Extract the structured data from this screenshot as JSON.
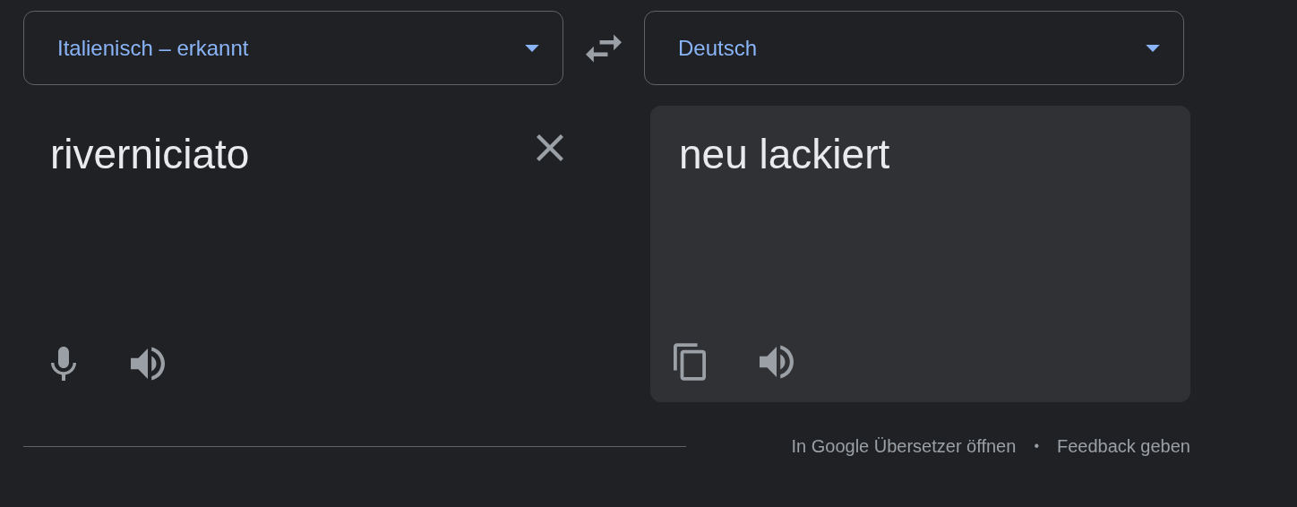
{
  "source_language": {
    "label": "Italienisch – erkannt"
  },
  "target_language": {
    "label": "Deutsch"
  },
  "source_text": "riverniciato",
  "translation": "neu lackiert",
  "footer_links": [
    "In Google Übersetzer öffnen",
    "Feedback geben"
  ],
  "footer_separator": "•"
}
